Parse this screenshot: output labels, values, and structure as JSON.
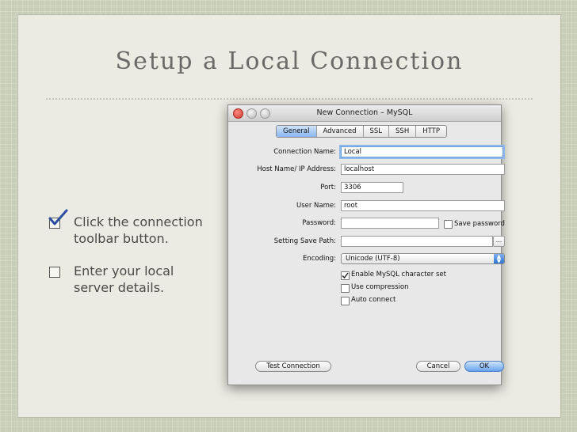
{
  "slide": {
    "title": "Setup a Local Connection",
    "bullets": [
      {
        "text_line1": "Click the connection",
        "text_line2": "toolbar button.",
        "checked": true
      },
      {
        "text_line1": "Enter your local",
        "text_line2": "server details.",
        "checked": false
      }
    ]
  },
  "dialog": {
    "title": "New Connection – MySQL",
    "tabs": [
      "General",
      "Advanced",
      "SSL",
      "SSH",
      "HTTP"
    ],
    "active_tab": "General",
    "fields": {
      "connection_name": {
        "label": "Connection Name:",
        "value": "Local"
      },
      "host_name": {
        "label": "Host Name/ IP Address:",
        "value": "localhost"
      },
      "port": {
        "label": "Port:",
        "value": "3306"
      },
      "user_name": {
        "label": "User Name:",
        "value": "root"
      },
      "password": {
        "label": "Password:",
        "value": ""
      },
      "save_path": {
        "label": "Setting Save Path:",
        "value": ""
      },
      "encoding": {
        "label": "Encoding:",
        "value": "Unicode (UTF-8)"
      }
    },
    "save_password": {
      "label": "Save password",
      "checked": false
    },
    "browse_label": "...",
    "options": [
      {
        "label": "Enable MySQL character set",
        "checked": true
      },
      {
        "label": "Use compression",
        "checked": false
      },
      {
        "label": "Auto connect",
        "checked": false
      }
    ],
    "buttons": {
      "test": "Test Connection",
      "cancel": "Cancel",
      "ok": "OK"
    }
  },
  "colors": {
    "check_mark": "#2d4fa0",
    "accent": "#6aa3ec"
  }
}
